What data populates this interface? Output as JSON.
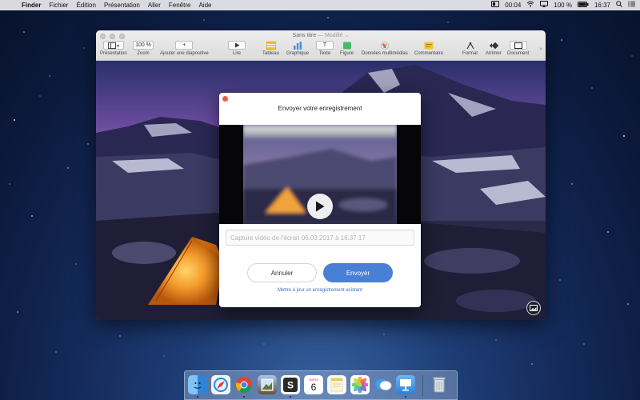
{
  "menubar": {
    "app_name": "Finder",
    "menus": [
      "Fichier",
      "Édition",
      "Présentation",
      "Aller",
      "Fenêtre",
      "Aide"
    ],
    "time": "00:04",
    "battery": "100 %",
    "clock": "16:37"
  },
  "window": {
    "title": "Sans titre",
    "title_separator": "—",
    "modified": "Modifié",
    "toolbar": {
      "presentation": "Présentation",
      "zoom_value": "100 %",
      "zoom": "Zoom",
      "add_slide": "Ajouter une diapositive",
      "play": "Lire",
      "table": "Tableau",
      "chart": "Graphique",
      "text": "Texte",
      "shape": "Figure",
      "media": "Données multimédias",
      "comment": "Commentaire",
      "format": "Format",
      "arrange": "Arrimer",
      "document": "Document"
    }
  },
  "dialog": {
    "title": "Envoyer votre enregistrement",
    "caption_placeholder": "Capture vidéo de l'écran 06.03.2017 à 16.37.17",
    "cancel": "Annuler",
    "send": "Envoyer",
    "update_link": "Mettre à jour un enregistrement existant"
  },
  "dock": {
    "calendar_month": "MARS",
    "calendar_day": "6"
  },
  "colors": {
    "accent": "#4a7fd6",
    "link": "#3b6cc0",
    "close": "#ec5a52"
  }
}
